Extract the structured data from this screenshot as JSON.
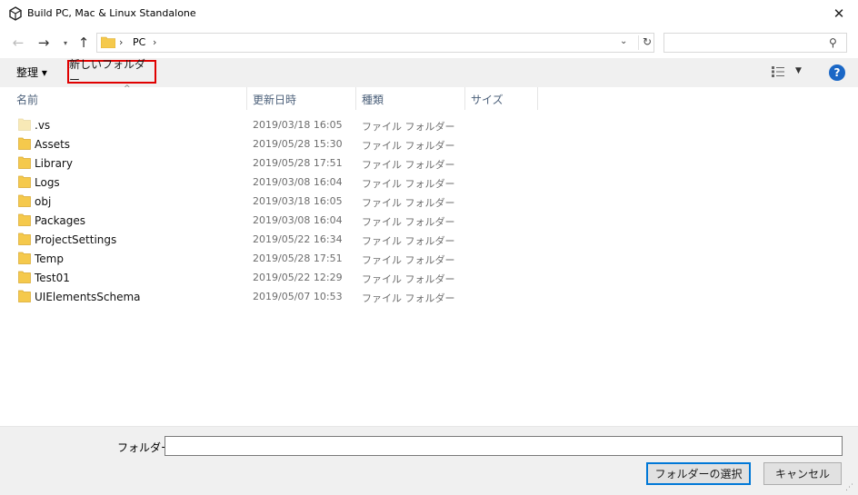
{
  "window": {
    "title": "Build PC, Mac & Linux Standalone"
  },
  "nav": {
    "back_icon": "back-arrow-icon",
    "forward_icon": "forward-arrow-icon",
    "recent_icon": "chevron-down-icon",
    "up_icon": "up-arrow-icon"
  },
  "path": {
    "crumb": "PC",
    "sep": "›"
  },
  "search": {
    "placeholder": ""
  },
  "toolbar": {
    "organize_label": "整理 ▾",
    "new_folder_label": "新しいフォルダー"
  },
  "columns": {
    "name": "名前",
    "date": "更新日時",
    "type": "種類",
    "size": "サイズ"
  },
  "files": [
    {
      "name": ".vs",
      "date": "2019/03/18 16:05",
      "type": "ファイル フォルダー",
      "hidden": true
    },
    {
      "name": "Assets",
      "date": "2019/05/28 15:30",
      "type": "ファイル フォルダー",
      "hidden": false
    },
    {
      "name": "Library",
      "date": "2019/05/28 17:51",
      "type": "ファイル フォルダー",
      "hidden": false
    },
    {
      "name": "Logs",
      "date": "2019/03/08 16:04",
      "type": "ファイル フォルダー",
      "hidden": false
    },
    {
      "name": "obj",
      "date": "2019/03/18 16:05",
      "type": "ファイル フォルダー",
      "hidden": false
    },
    {
      "name": "Packages",
      "date": "2019/03/08 16:04",
      "type": "ファイル フォルダー",
      "hidden": false
    },
    {
      "name": "ProjectSettings",
      "date": "2019/05/22 16:34",
      "type": "ファイル フォルダー",
      "hidden": false
    },
    {
      "name": "Temp",
      "date": "2019/05/28 17:51",
      "type": "ファイル フォルダー",
      "hidden": false
    },
    {
      "name": "Test01",
      "date": "2019/05/22 12:29",
      "type": "ファイル フォルダー",
      "hidden": false
    },
    {
      "name": "UIElementsSchema",
      "date": "2019/05/07 10:53",
      "type": "ファイル フォルダー",
      "hidden": false
    }
  ],
  "footer": {
    "folder_label": "フォルダー:",
    "folder_value": "",
    "select_button": "フォルダーの選択",
    "cancel_button": "キャンセル"
  },
  "colors": {
    "highlight": "#e00000",
    "folder": "#f5c94c",
    "folder_hidden": "#f8e9b6",
    "help": "#1a67c6"
  }
}
